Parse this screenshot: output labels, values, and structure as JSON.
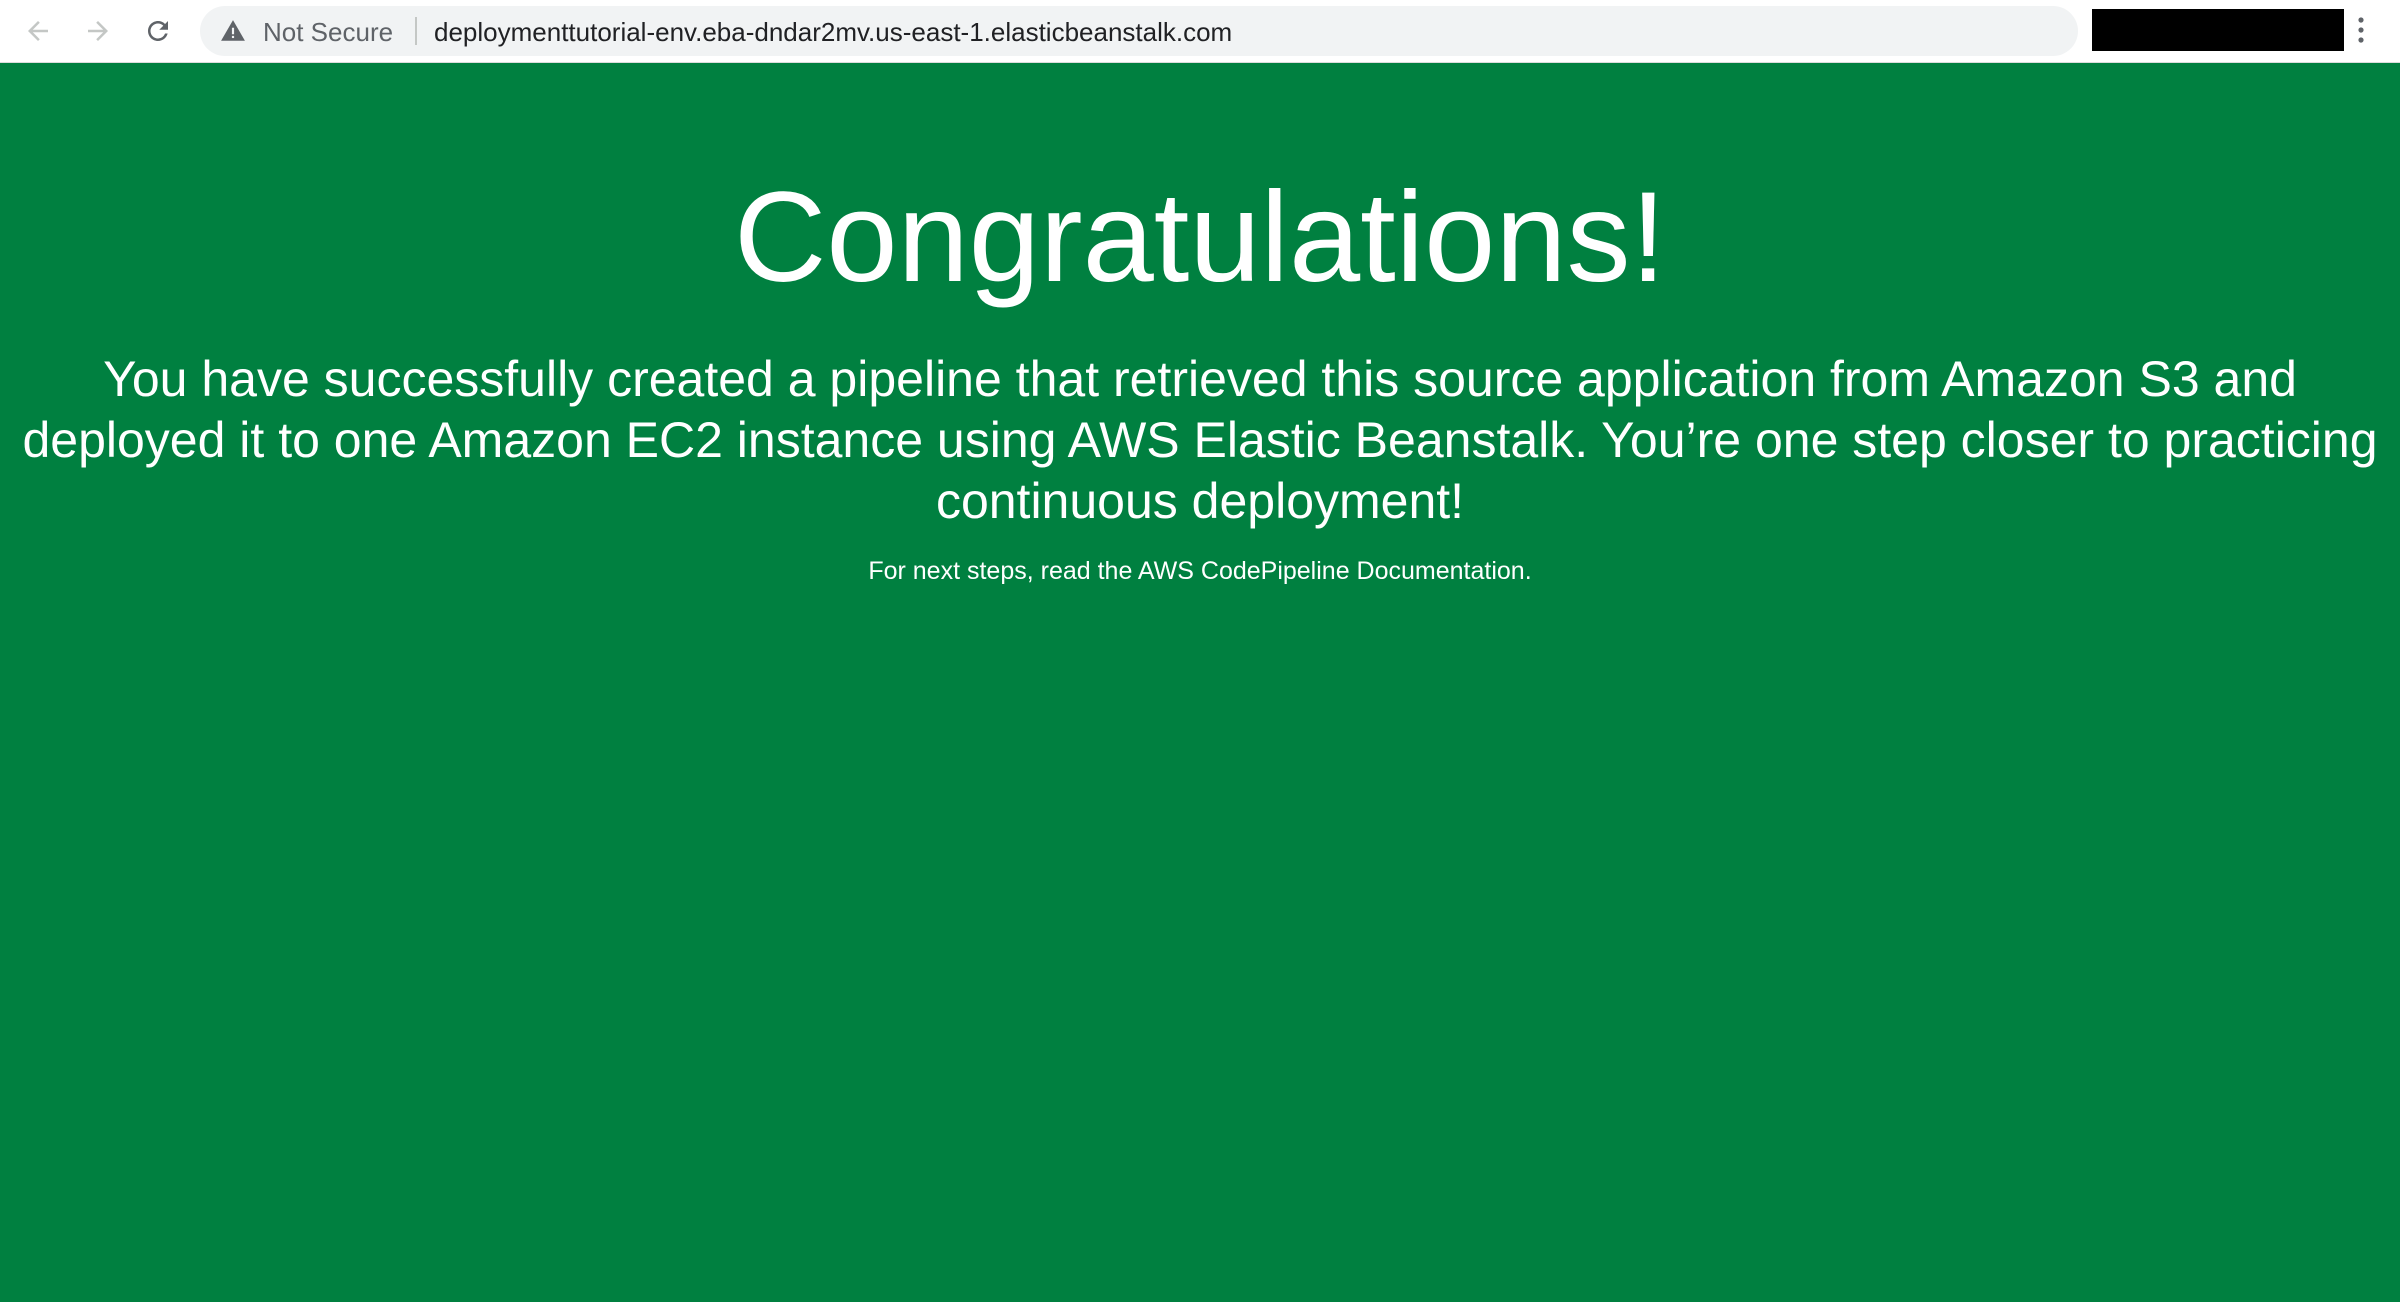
{
  "browser": {
    "security_label": "Not Secure",
    "url": "deploymenttutorial-env.eba-dndar2mv.us-east-1.elasticbeanstalk.com",
    "icons": {
      "back": "arrow-left-icon",
      "forward": "arrow-right-icon",
      "reload": "reload-icon",
      "warning": "warning-triangle-icon",
      "share": "share-icon",
      "bookmark": "star-icon",
      "menu": "kebab-menu-icon"
    }
  },
  "page": {
    "headline": "Congratulations!",
    "body": "You have successfully created a pipeline that retrieved this source application from Amazon S3 and deployed it to one Amazon EC2 instance using AWS Elastic Beanstalk. You’re one step closer to practicing continuous deployment!",
    "next_steps": "For next steps, read the AWS CodePipeline Documentation."
  },
  "colors": {
    "page_background": "#008040",
    "page_text": "#ffffff",
    "omnibox_background": "#f1f3f4",
    "toolbar_background": "#ffffff"
  }
}
